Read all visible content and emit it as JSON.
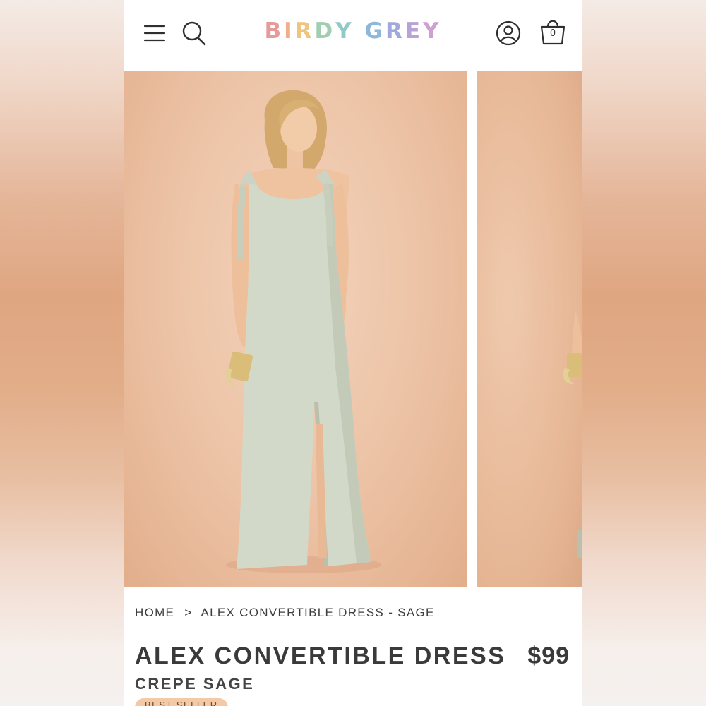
{
  "header": {
    "logo_letters": [
      {
        "char": "B",
        "color": "#e79a9a"
      },
      {
        "char": "I",
        "color": "#efb089"
      },
      {
        "char": "R",
        "color": "#eec47e"
      },
      {
        "char": "D",
        "color": "#9fcfb0"
      },
      {
        "char": "Y",
        "color": "#8fc9c8"
      },
      {
        "char": " ",
        "color": "#ffffff"
      },
      {
        "char": "G",
        "color": "#8fb7d9"
      },
      {
        "char": "R",
        "color": "#a0a8dc"
      },
      {
        "char": "E",
        "color": "#b8a3d8"
      },
      {
        "char": "Y",
        "color": "#cf9fd2"
      }
    ],
    "icons": [
      "menu-icon",
      "search-icon",
      "account-icon",
      "cart-icon"
    ],
    "cart_count": "0"
  },
  "gallery": {
    "background_color": "#ecc2a4",
    "dress_color": "#d3d9c9"
  },
  "product": {
    "breadcrumb": {
      "home": "HOME",
      "separator": ">",
      "current": "ALEX CONVERTIBLE DRESS - SAGE"
    },
    "title": "ALEX CONVERTIBLE DRESS",
    "price": "$99",
    "subtitle": "CREPE SAGE",
    "badge": "BEST SELLER"
  }
}
